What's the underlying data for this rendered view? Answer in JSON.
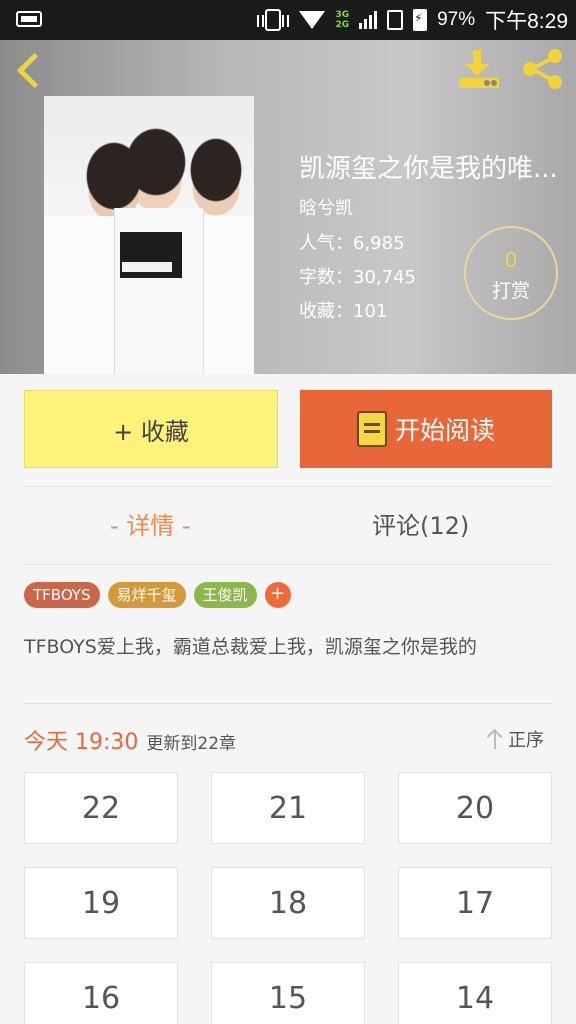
{
  "status_bar": {
    "network_top": "3G",
    "network_bottom": "2G",
    "battery_percent": "97%",
    "time": "下午8:29"
  },
  "header": {
    "back_icon": "chevron-left-icon",
    "download_icon": "download-icon",
    "share_icon": "share-icon",
    "title": "凯源玺之你是我的唯...",
    "author": "晗兮凯",
    "popularity": "人气：6,985",
    "word_count": "字数：30,745",
    "favorites": "收藏：101",
    "reward": {
      "count": "0",
      "label": "打赏"
    }
  },
  "actions": {
    "favorite_label": "+ 收藏",
    "read_label": "开始阅读"
  },
  "tabs": {
    "detail": "- 详情 -",
    "comments": "评论(12)"
  },
  "tags": [
    {
      "label": "TFBOYS",
      "color": "#c8674a"
    },
    {
      "label": "易烊千玺",
      "color": "#d39a3c"
    },
    {
      "label": "王俊凯",
      "color": "#8cb84a"
    }
  ],
  "tag_add": "+",
  "description": "TFBOYS爱上我，霸道总裁爱上我，凯源玺之你是我的",
  "update": {
    "time": "今天 19:30",
    "text": "更新到22章",
    "sort_label": "正序"
  },
  "chapters": [
    "22",
    "21",
    "20",
    "19",
    "18",
    "17",
    "16",
    "15",
    "14"
  ],
  "colors": {
    "accent_orange": "#e8673a",
    "favorite_yellow": "#fff27a",
    "icon_yellow": "#f2d33a"
  }
}
